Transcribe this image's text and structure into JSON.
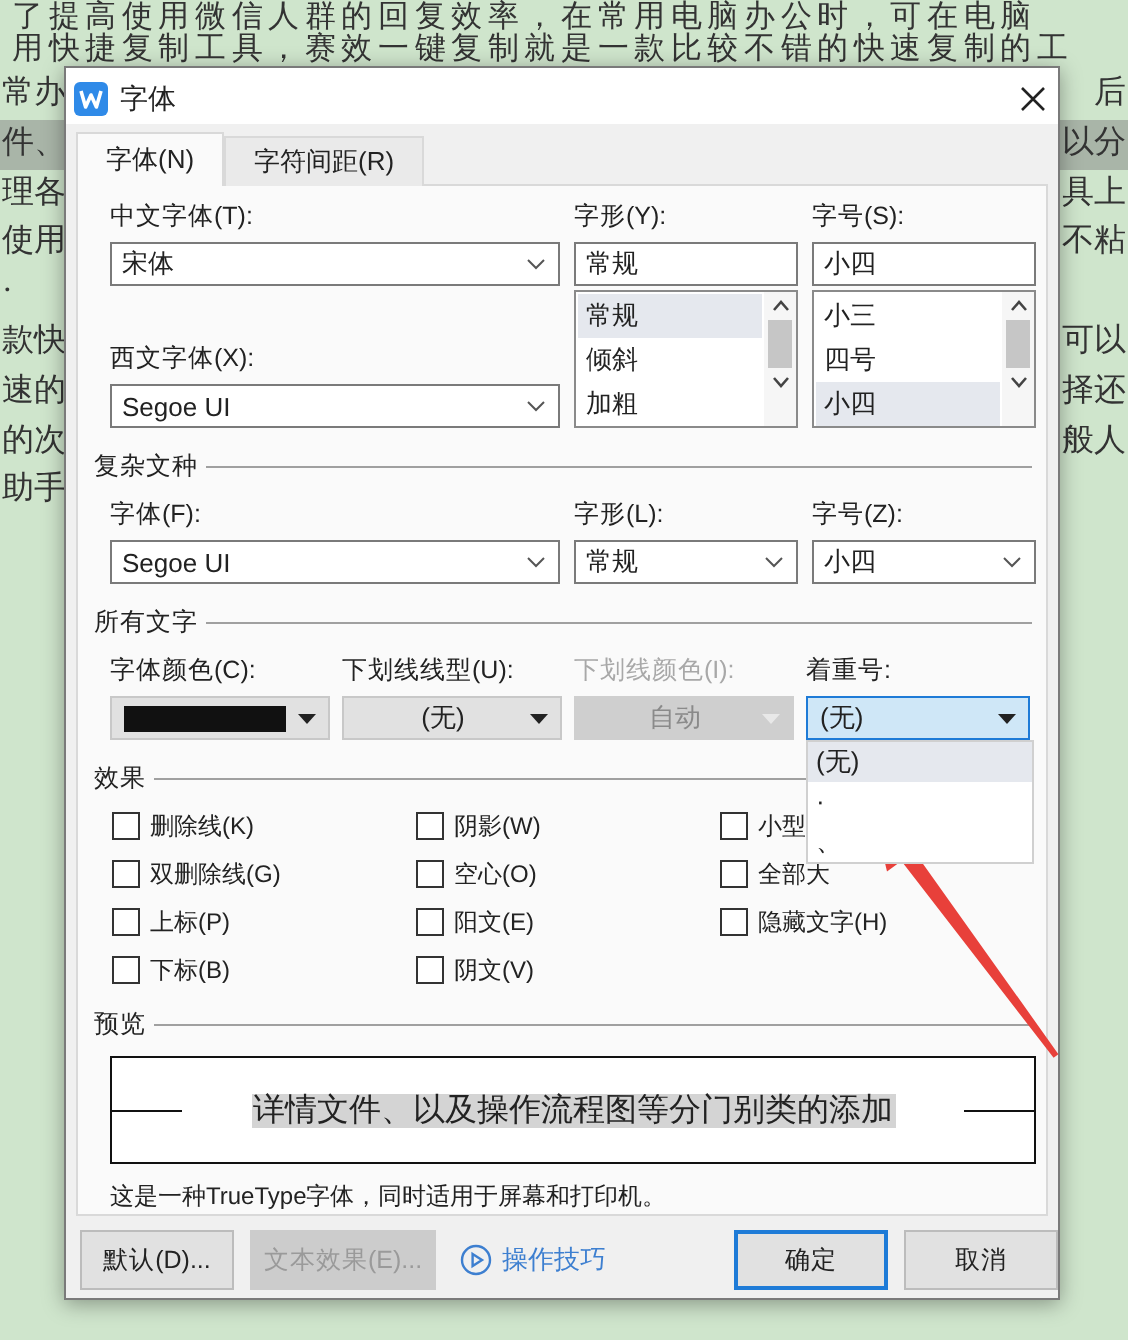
{
  "background": {
    "lines": [
      "了提高使用微信人群的回复效率，在常用电脑办公时，可在电脑",
      "用快捷复制工具，赛效一键复制就是一款比较不错的快速复制的工"
    ],
    "rows": [
      {
        "left": "常办",
        "right": "后",
        "highlighted": false
      },
      {
        "left": "件、",
        "right": "以分",
        "highlighted": true
      },
      {
        "left": "理各",
        "right": "具上",
        "highlighted": false
      },
      {
        "left": "使用",
        "right": "不粘",
        "highlighted": false
      },
      {
        "left": "·",
        "highlighted": false
      },
      {
        "left": "款快",
        "right": "可以",
        "highlighted": false
      },
      {
        "left": "速的",
        "right": "择还",
        "highlighted": false
      },
      {
        "left": "的次",
        "right": "般人",
        "highlighted": false
      },
      {
        "left": "助手",
        "highlighted": false
      }
    ]
  },
  "dialog": {
    "title": "字体",
    "tabs": [
      {
        "label": "字体(N)",
        "selected": true
      },
      {
        "label": "字符间距(R)",
        "selected": false
      }
    ],
    "chinese_font": {
      "label": "中文字体(T):",
      "value": "宋体"
    },
    "style": {
      "label": "字形(Y):",
      "value": "常规",
      "options": [
        {
          "label": "常规",
          "selected": true
        },
        {
          "label": "倾斜",
          "selected": false
        },
        {
          "label": "加粗",
          "selected": false
        }
      ]
    },
    "size": {
      "label": "字号(S):",
      "value": "小四",
      "options": [
        {
          "label": "小三",
          "selected": false
        },
        {
          "label": "四号",
          "selected": false
        },
        {
          "label": "小四",
          "selected": true
        }
      ]
    },
    "western_font": {
      "label": "西文字体(X):",
      "value": "Segoe UI"
    },
    "complex_script": {
      "title": "复杂文种",
      "font": {
        "label": "字体(F):",
        "value": "Segoe UI"
      },
      "style": {
        "label": "字形(L):",
        "value": "常规"
      },
      "size": {
        "label": "字号(Z):",
        "value": "小四"
      }
    },
    "all_text": {
      "title": "所有文字",
      "font_color": {
        "label": "字体颜色(C):",
        "color": "#111111"
      },
      "underline_style": {
        "label": "下划线线型(U):",
        "value": "(无)",
        "disabled": false
      },
      "underline_color": {
        "label": "下划线颜色(I):",
        "value": "自动",
        "disabled": true
      },
      "emphasis": {
        "label": "着重号:",
        "value": "(无)",
        "expanded": true,
        "options": [
          {
            "label": "(无)",
            "selected": true
          },
          {
            "label": "·",
            "selected": false
          },
          {
            "label": "、",
            "selected": false
          }
        ]
      }
    },
    "effects": {
      "title": "效果",
      "columns": [
        [
          {
            "label": "删除线(K)",
            "checked": false
          },
          {
            "label": "双删除线(G)",
            "checked": false
          },
          {
            "label": "上标(P)",
            "checked": false
          },
          {
            "label": "下标(B)",
            "checked": false
          }
        ],
        [
          {
            "label": "阴影(W)",
            "checked": false
          },
          {
            "label": "空心(O)",
            "checked": false
          },
          {
            "label": "阳文(E)",
            "checked": false
          },
          {
            "label": "阴文(V)",
            "checked": false
          }
        ],
        [
          {
            "label": "小型",
            "checked": false
          },
          {
            "label": "全部大",
            "checked": false
          },
          {
            "label": "隐藏文字(H)",
            "checked": false
          }
        ]
      ]
    },
    "preview": {
      "title": "预览",
      "sample": "详情文件、以及操作流程图等分门别类的添加",
      "note": "这是一种TrueType字体，同时适用于屏幕和打印机。"
    },
    "buttons": [
      {
        "kind": "button",
        "label": "默认(D)...",
        "disabled": false,
        "default": false
      },
      {
        "kind": "button",
        "label": "文本效果(E)...",
        "disabled": true,
        "default": false
      },
      {
        "kind": "link",
        "label": "操作技巧"
      },
      {
        "kind": "button",
        "label": "确定",
        "disabled": false,
        "default": true
      },
      {
        "kind": "button",
        "label": "取消",
        "disabled": false,
        "default": false
      }
    ]
  }
}
